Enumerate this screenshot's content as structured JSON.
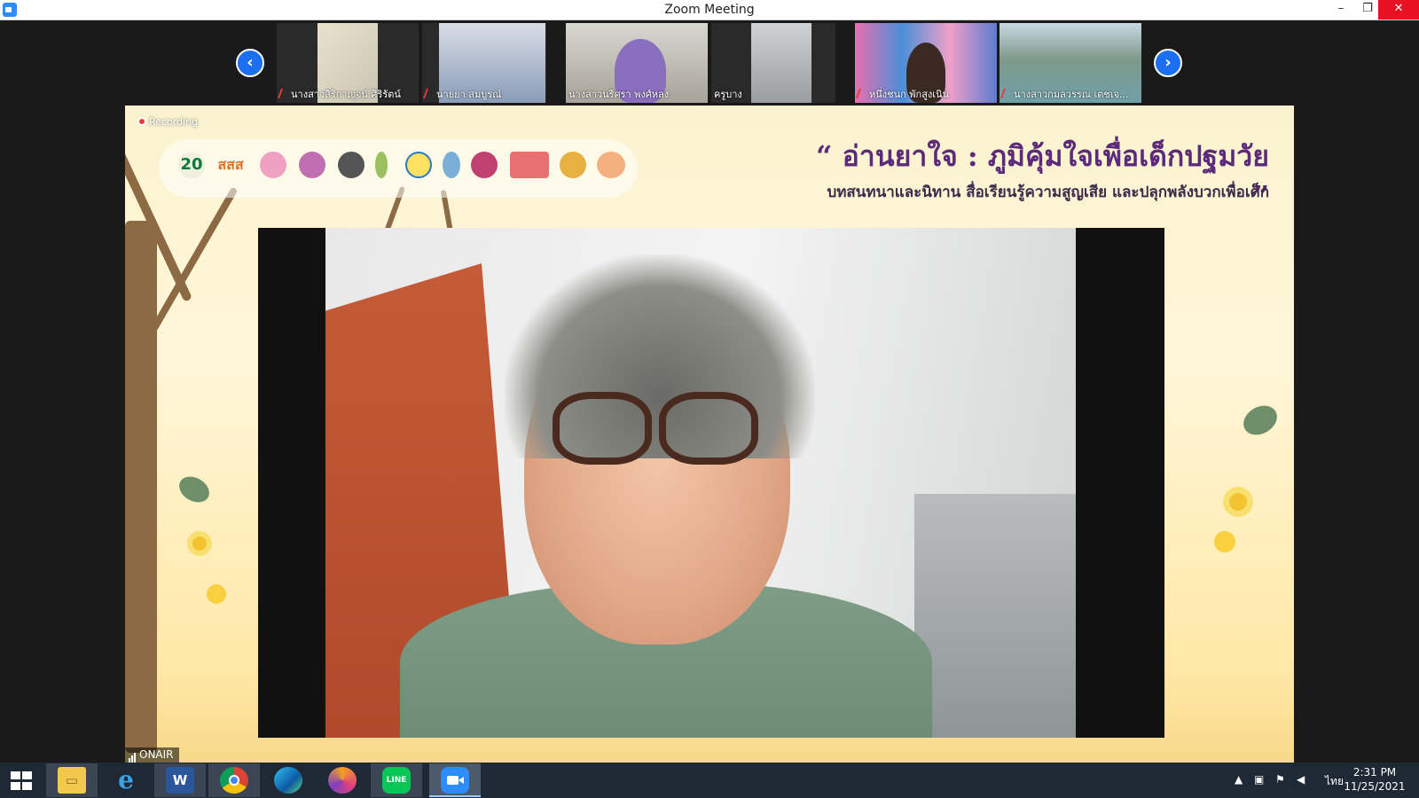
{
  "window": {
    "title": "Zoom Meeting",
    "minimize": "–",
    "maximize": "❐",
    "close": "✕"
  },
  "gallery": {
    "prev": "‹",
    "next": "›",
    "participants": [
      {
        "name": "นางสาวสิริกาญจน์ ศิริรัตน์",
        "muted": true
      },
      {
        "name": "นายยา สมบูรณ์",
        "muted": true
      },
      {
        "name": "นางสาวนริศรา พงศ์หลง",
        "muted": false
      },
      {
        "name": "ครูบาง",
        "muted": false
      },
      {
        "name": "หนึ่งชนก พักสูงเนิน",
        "muted": true
      },
      {
        "name": "นางสาวกมลวรรณ เตชเจ...",
        "muted": true
      }
    ]
  },
  "share": {
    "recording": "Recording",
    "headline": "“ อ่านยาใจ : ภูมิคุ้มใจเพื่อเด็กปฐมวัย ”",
    "subline": "บทสนทนาและนิทาน สื่อเรียนรู้ความสูญเสีย และปลุกพลังบวกเพื่อเด็ก",
    "onair": "ONAIR",
    "logos": [
      "20",
      "สสส",
      "",
      "",
      "",
      "",
      "",
      "",
      "",
      "",
      "",
      ""
    ]
  },
  "taskbar": {
    "apps": [
      {
        "icon": "file-explorer-icon",
        "glyph": "▭"
      },
      {
        "icon": "internet-explorer-icon",
        "glyph": "e"
      },
      {
        "icon": "word-icon",
        "glyph": "W"
      },
      {
        "icon": "chrome-icon",
        "glyph": ""
      },
      {
        "icon": "edge-icon",
        "glyph": ""
      },
      {
        "icon": "vpn-icon",
        "glyph": ""
      },
      {
        "icon": "line-icon",
        "glyph": "LINE"
      },
      {
        "icon": "zoom-icon",
        "glyph": ""
      }
    ],
    "language": "ไทย",
    "time": "2:31 PM",
    "date": "11/25/2021"
  },
  "colors": {
    "accent": "#2d8cff",
    "headline": "#5b2a7a",
    "close": "#e81123",
    "taskbar": "#1f2935"
  }
}
